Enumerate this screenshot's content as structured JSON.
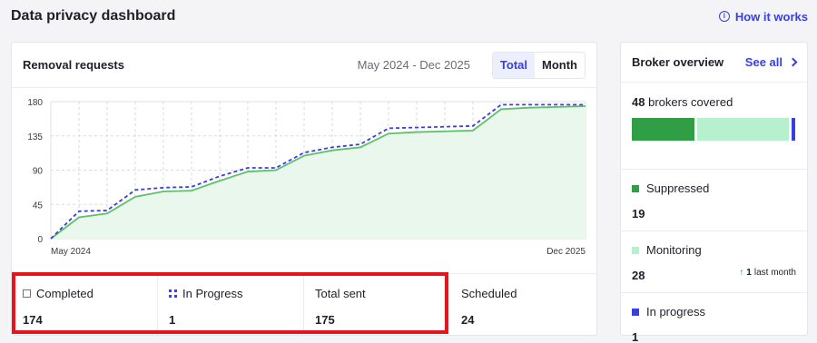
{
  "page": {
    "title": "Data privacy dashboard",
    "how_it_works": "How it works",
    "info_glyph": "i"
  },
  "removal": {
    "title": "Removal requests",
    "date_range": "May 2024 - Dec 2025",
    "toggle": {
      "total": "Total",
      "month": "Month",
      "active": "total"
    }
  },
  "chart_data": {
    "type": "area",
    "x_start_label": "May 2024",
    "x_end_label": "Dec 2025",
    "yticks": [
      0,
      45,
      90,
      135,
      180
    ],
    "ylim": [
      0,
      180
    ],
    "grid": true,
    "series": [
      {
        "name": "Completed",
        "color": "#5fbf6a",
        "fill": "#e9f7ec",
        "values": [
          0,
          28,
          33,
          55,
          62,
          63,
          76,
          88,
          90,
          109,
          116,
          120,
          138,
          140,
          141,
          142,
          170,
          172,
          173,
          174
        ]
      },
      {
        "name": "In Progress",
        "color": "#3740e0",
        "dashed": true,
        "values": [
          0,
          36,
          37,
          64,
          67,
          68,
          82,
          93,
          93,
          113,
          120,
          124,
          145,
          146,
          147,
          148,
          176,
          176,
          176,
          176
        ]
      }
    ]
  },
  "stats": [
    {
      "key": "completed",
      "label": "Completed",
      "value": "174",
      "marker": "square-outline"
    },
    {
      "key": "in_progress",
      "label": "In Progress",
      "value": "1",
      "marker": "dots"
    },
    {
      "key": "total_sent",
      "label": "Total sent",
      "value": "175",
      "marker": "none"
    },
    {
      "key": "scheduled",
      "label": "Scheduled",
      "value": "24",
      "marker": "none"
    }
  ],
  "broker": {
    "title": "Broker overview",
    "see_all": "See all",
    "covered_count": "48",
    "covered_text": "brokers covered",
    "bar": {
      "suppressed": 19,
      "monitoring": 28,
      "in_progress": 1,
      "total": 48
    },
    "items": [
      {
        "label": "Suppressed",
        "value": "19",
        "color": "#2f9e44"
      },
      {
        "label": "Monitoring",
        "value": "28",
        "color": "#b7f0cd",
        "trend": {
          "arrow": "↑",
          "count": "1",
          "text": "last month"
        }
      },
      {
        "label": "In progress",
        "value": "1",
        "color": "#3740e0"
      }
    ]
  },
  "colors": {
    "accent": "#3740e0",
    "completed": "#2f9e44",
    "monitoring": "#b7f0cd",
    "highlight": "#e8141c"
  }
}
